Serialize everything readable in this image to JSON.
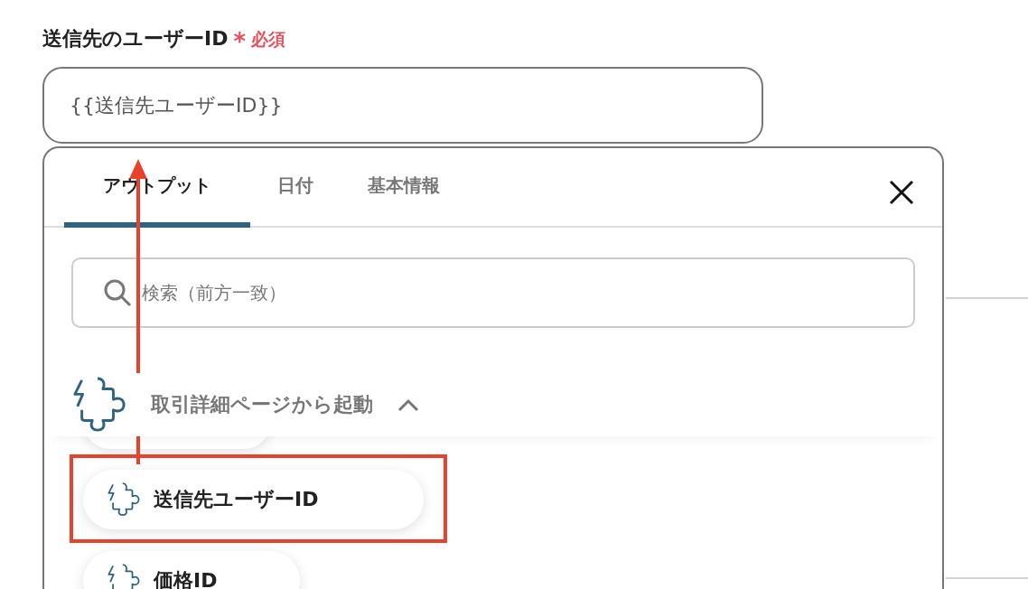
{
  "field": {
    "label": "送信先のユーザーID",
    "required_mark": "*",
    "required_text": "必須",
    "value": "{{送信先ユーザーID}}"
  },
  "panel": {
    "tabs": [
      {
        "label": "アウトプット",
        "selected": true
      },
      {
        "label": "日付",
        "selected": false
      },
      {
        "label": "基本情報",
        "selected": false
      }
    ],
    "search": {
      "placeholder": "検索（前方一致）"
    },
    "group": {
      "title": "取引詳細ページから起動",
      "expanded": true,
      "items": [
        {
          "label": "送信先ユーザーID",
          "highlighted": true
        },
        {
          "label": "価格ID",
          "highlighted": false
        }
      ]
    }
  }
}
